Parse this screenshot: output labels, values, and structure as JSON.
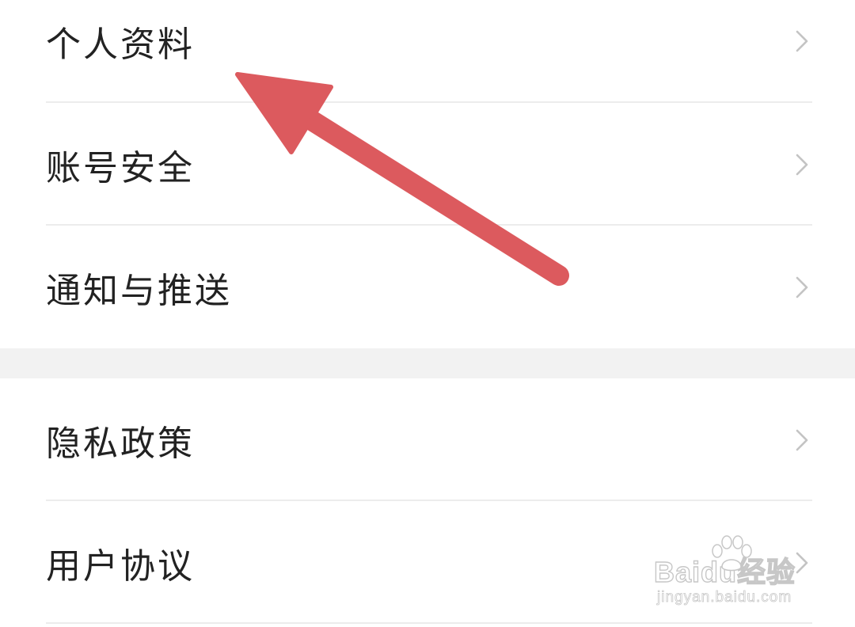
{
  "settings": {
    "group1": [
      {
        "label": "个人资料"
      },
      {
        "label": "账号安全"
      },
      {
        "label": "通知与推送"
      }
    ],
    "group2": [
      {
        "label": "隐私政策"
      },
      {
        "label": "用户协议"
      }
    ]
  },
  "annotation": {
    "arrow_color": "#dc5a5e",
    "points_to": "个人资料"
  },
  "watermark": {
    "logo_text": "Baidu经验",
    "url": "jingyan.baidu.com"
  },
  "colors": {
    "text": "#222222",
    "divider": "#ececec",
    "section_gap": "#f2f2f2",
    "chevron": "#c4c4c4"
  }
}
